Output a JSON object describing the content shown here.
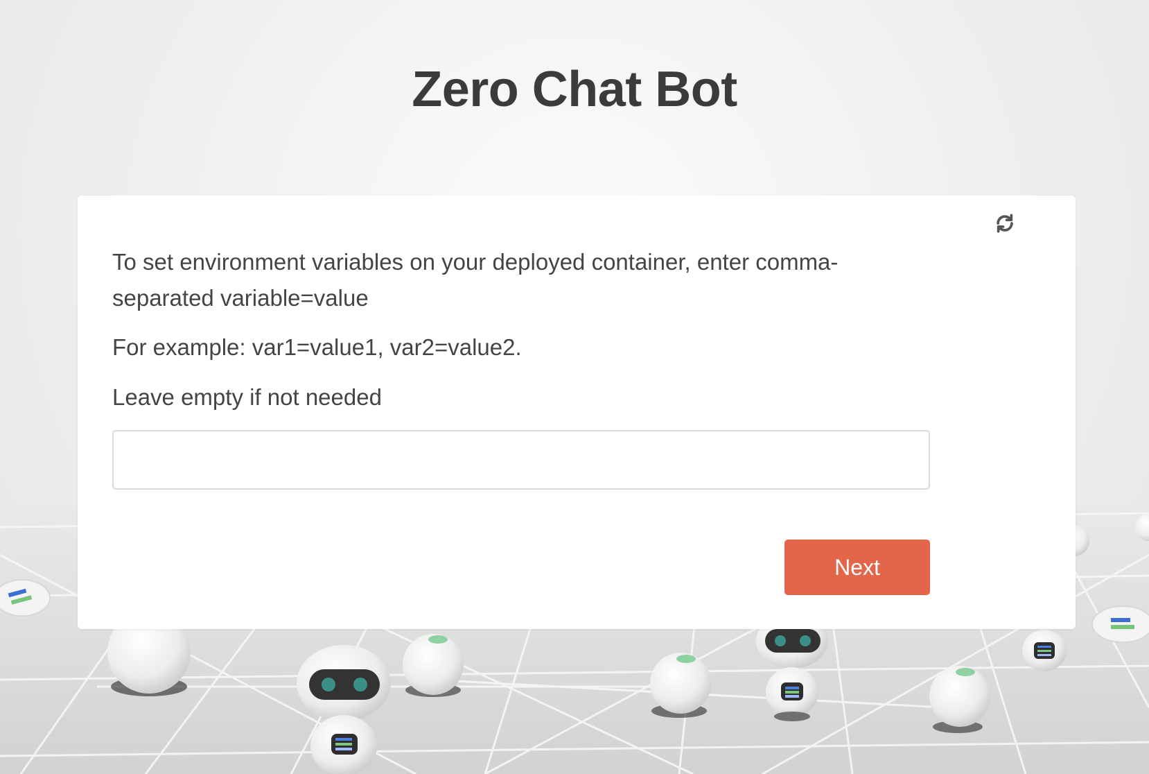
{
  "header": {
    "title": "Zero Chat Bot"
  },
  "form": {
    "intro_text": "To set environment variables on your deployed container, enter comma-separated variable=value",
    "example_text": "For example: var1=value1, var2=value2.",
    "hint_text": "Leave empty if not needed",
    "env_input_value": "",
    "env_input_placeholder": "",
    "next_label": "Next",
    "refresh_icon": "refresh-icon"
  },
  "colors": {
    "accent": "#e3664b",
    "title_text": "#3b3b3b",
    "body_text": "#444444",
    "card_bg": "#ffffff"
  }
}
